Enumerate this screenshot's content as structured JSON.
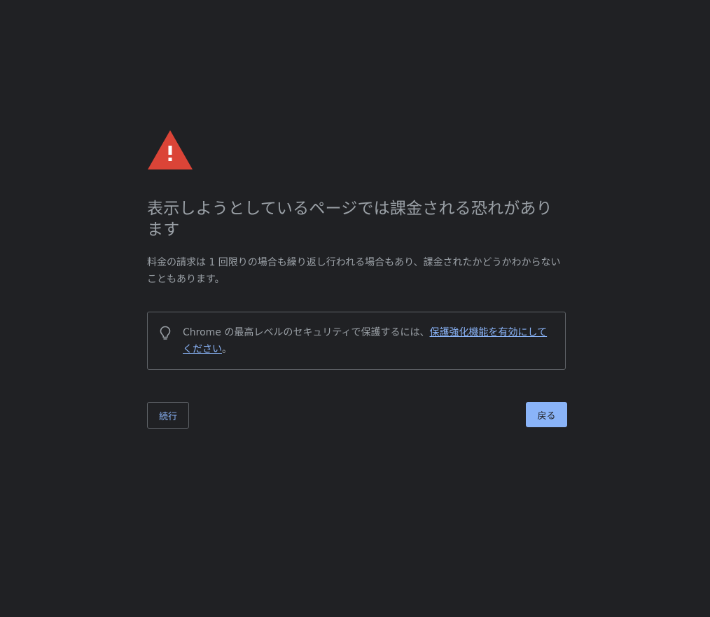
{
  "interstitial": {
    "title": "表示しようとしているページでは課金される恐れがあります",
    "description": "料金の請求は 1 回限りの場合も繰り返し行われる場合もあり、課金されたかどうかわからないこともあります。",
    "tip": {
      "text_before": "Chrome の最高レベルのセキュリティで保護するには、",
      "link_text": "保護強化機能を有効にしてください",
      "text_after": "。",
      "icon": "lightbulb-icon"
    },
    "warning_icon": "warning-triangle-icon",
    "continue_label": "続行",
    "back_label": "戻る"
  },
  "colors": {
    "background": "#202124",
    "text": "#9aa0a6",
    "link": "#8ab4f8",
    "warning": "#db4437",
    "border": "#5f6368",
    "primary_button": "#8ab4f8"
  }
}
